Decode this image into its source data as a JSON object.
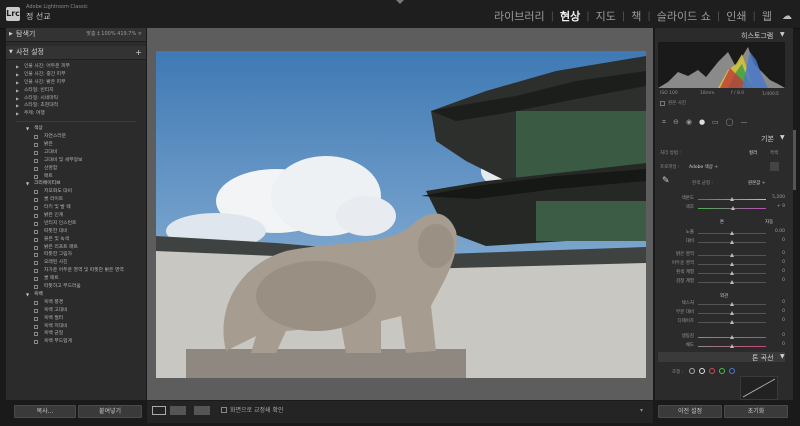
{
  "app": {
    "logo": "Lrc",
    "name": "Adobe Lightroom Classic",
    "user": "정 선교"
  },
  "modules": [
    "라이브러리",
    "현상",
    "지도",
    "책",
    "슬라이드 쇼",
    "인쇄",
    "웹"
  ],
  "active_module": "현상",
  "navigator": {
    "title": "탐색기",
    "zoom": "맞춤 ‡  100%  419.7% ≑"
  },
  "presets": {
    "title": "사전 설정",
    "folders": [
      "인물 사진: 어두운 피부",
      "인물 사진: 중간 피부",
      "인물 사진: 밝은 피부",
      "스타일: 빈티지",
      "스타일: 시네마틱",
      "스타일: 초현대적",
      "주제: 여행"
    ],
    "groups": [
      {
        "name": "색상",
        "items": [
          "자연스러운",
          "밝은",
          "고대비",
          "고대비 및 세부정보",
          "선명함",
          "매트"
        ]
      },
      {
        "name": "크리에이티브",
        "items": [
          "저포화도 대비",
          "쿨 라이트",
          "타키 및 발 웨",
          "밝은 인계",
          "빈티지 인스턴트",
          "따뜻한 대비",
          "붉은 및 녹색",
          "밝은 리프트 매트",
          "따뜻한 그림자",
          "오래된 사진",
          "차가운 어두운 영역 및 따뜻한 밝은 영역",
          "쿨 매트",
          "따뜻하고 부드러움"
        ]
      },
      {
        "name": "흑백",
        "items": [
          "흑백 풍경",
          "흑백 고대비",
          "흑백 필터",
          "흑백 저대비",
          "흑백 균일",
          "흑백 부드럽게"
        ]
      }
    ],
    "copy": "복사...",
    "paste": "붙여넣기"
  },
  "toolbar": {
    "softproof": "화면으로 교정쇄 확인"
  },
  "histogram": {
    "title": "히스토그램",
    "iso": "ISO 100",
    "focal": "18mm",
    "aperture": "f / 8.0",
    "shutter": "1/400초",
    "original": "원본 사진"
  },
  "basic": {
    "title": "기본",
    "treatment_label": "처리 방법 :",
    "color": "컬러",
    "bw": "흑백",
    "profile_label": "프로파일 :",
    "profile": "Adobe 색상 ÷",
    "wb_label": "흰색 균형 :",
    "wb_value": "원본값 ÷",
    "sliders": [
      {
        "label": "색온도",
        "value": "5,200",
        "pos": 0.5
      },
      {
        "label": "색조",
        "value": "+ 9",
        "pos": 0.52
      },
      {
        "label": "노출",
        "value": "0.00",
        "pos": 0.5
      },
      {
        "label": "대비",
        "value": "0",
        "pos": 0.5
      },
      {
        "label": "밝은 영역",
        "value": "0",
        "pos": 0.5
      },
      {
        "label": "어두운 영역",
        "value": "0",
        "pos": 0.5
      },
      {
        "label": "흰색 계열",
        "value": "0",
        "pos": 0.5
      },
      {
        "label": "검정 계열",
        "value": "0",
        "pos": 0.5
      },
      {
        "label": "텍스처",
        "value": "0",
        "pos": 0.5
      },
      {
        "label": "부분 대비",
        "value": "0",
        "pos": 0.5
      },
      {
        "label": "디헤이즈",
        "value": "0",
        "pos": 0.5
      },
      {
        "label": "생동감",
        "value": "0",
        "pos": 0.5
      },
      {
        "label": "채도",
        "value": "0",
        "pos": 0.5
      }
    ],
    "tone": "톤",
    "auto": "자동",
    "presence": "외관"
  },
  "tone_curve": {
    "title": "톤 곡선",
    "adjust": "조정 :"
  },
  "buttons": {
    "previous": "이전 설정",
    "reset": "초기화"
  }
}
